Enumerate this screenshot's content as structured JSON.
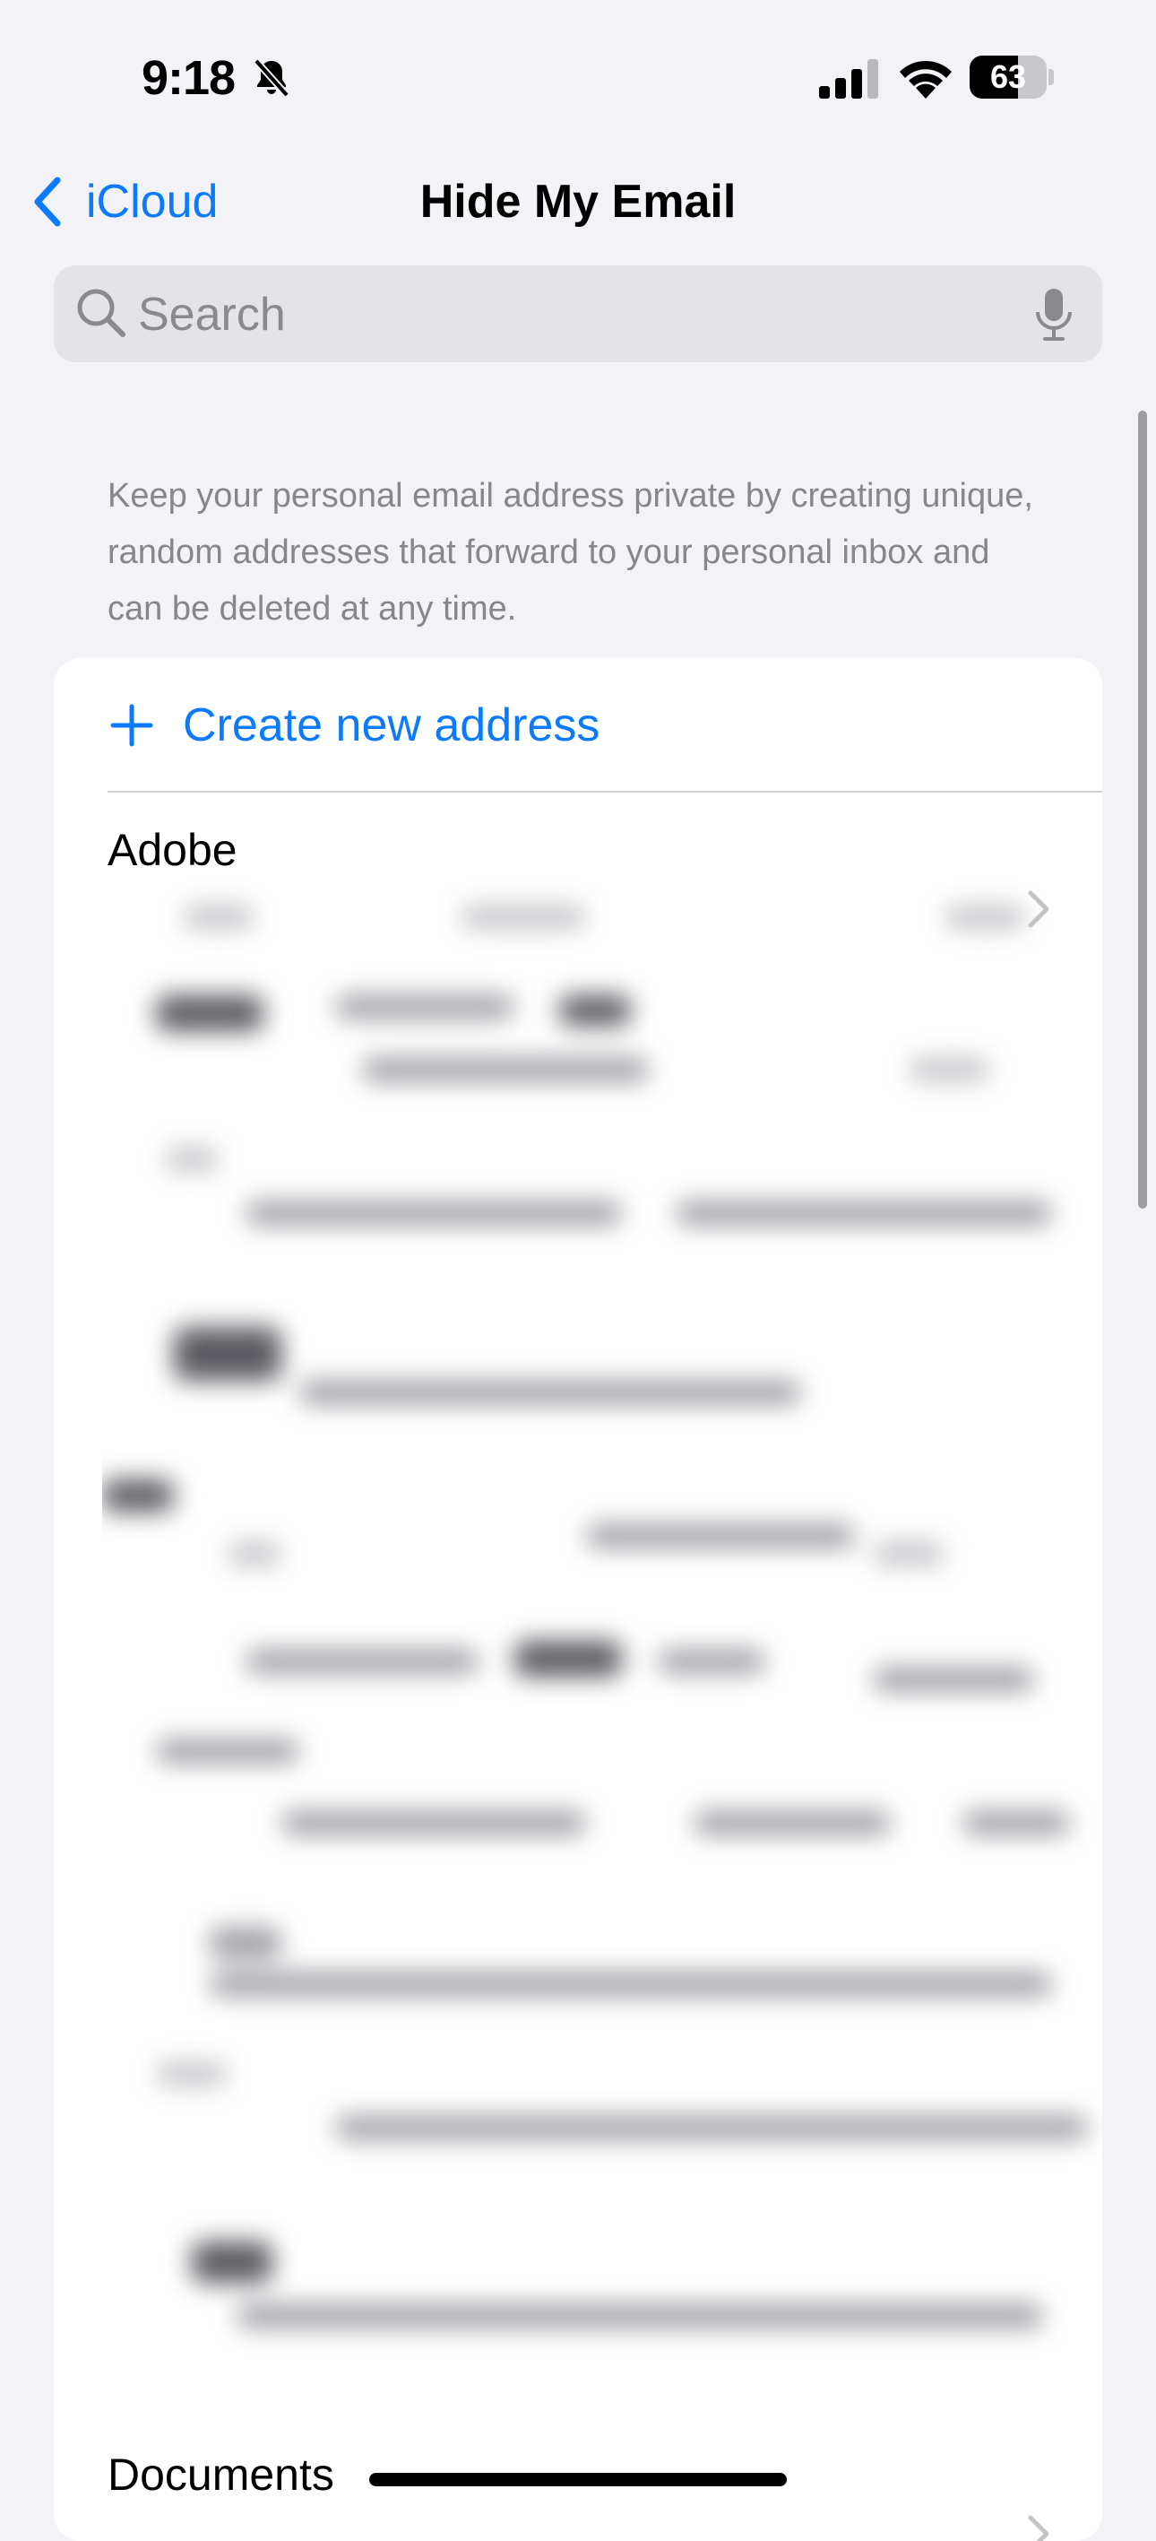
{
  "status_bar": {
    "time": "9:18",
    "silent_icon": "bell-slash-icon",
    "signal_icon": "cellular-signal-icon",
    "wifi_icon": "wifi-icon",
    "battery_level": "63",
    "battery_fraction": 0.63
  },
  "nav": {
    "back_label": "iCloud",
    "back_icon": "chevron-left-icon",
    "title": "Hide My Email"
  },
  "search": {
    "placeholder": "Search",
    "search_icon": "magnifying-glass-icon",
    "mic_icon": "microphone-icon"
  },
  "description": "Keep your personal email address private by creating unique, random addresses that forward to your personal inbox and can be deleted at any time.",
  "card": {
    "create_label": "Create new address",
    "create_icon": "plus-icon",
    "items": [
      {
        "label": "Adobe"
      },
      {
        "label": "Documents"
      }
    ]
  },
  "colors": {
    "accent": "#0a7aff",
    "background": "#f2f2f7",
    "card": "#ffffff",
    "secondary_text": "#86868b"
  }
}
